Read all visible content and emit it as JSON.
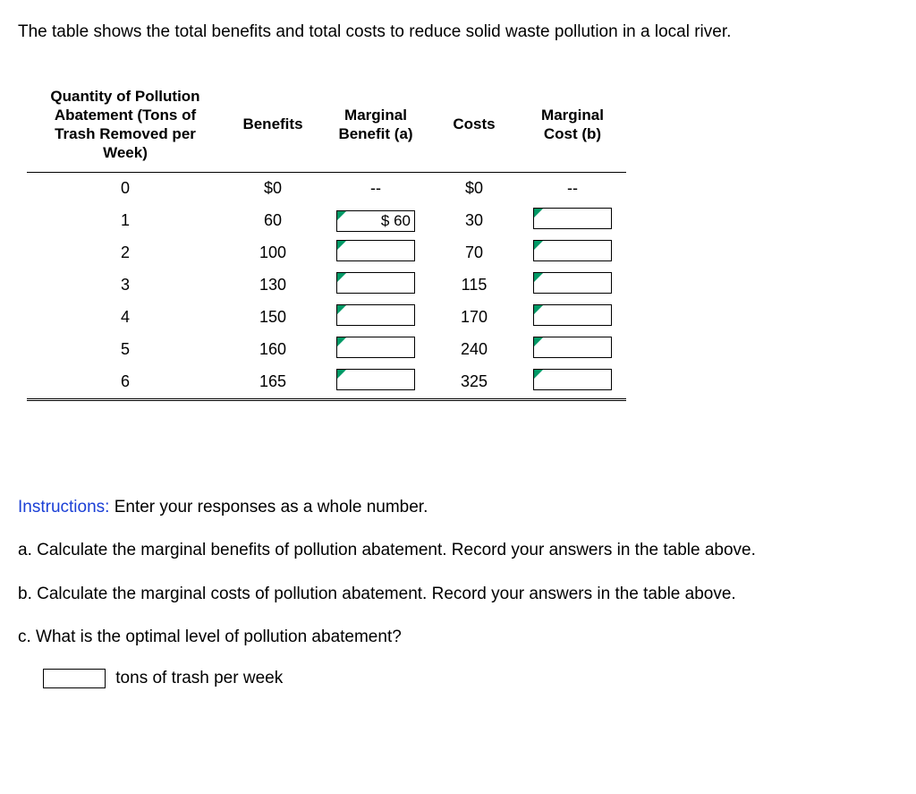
{
  "intro": "The table shows the total benefits and total costs to reduce solid waste pollution in a local river.",
  "headers": {
    "qty": "Quantity of Pollution Abatement (Tons of Trash Removed per Week)",
    "benefits": "Benefits",
    "mb": "Marginal Benefit (a)",
    "costs": "Costs",
    "mc": "Marginal Cost (b)"
  },
  "chart_data": {
    "type": "table",
    "columns": [
      "Quantity",
      "Benefits",
      "Marginal Benefit (a)",
      "Costs",
      "Marginal Cost (b)"
    ],
    "rows": [
      {
        "qty": "0",
        "benefits": "$0",
        "mb": "--",
        "costs": "$0",
        "mc": "--"
      },
      {
        "qty": "1",
        "benefits": "60",
        "mb": "$      60",
        "costs": "30",
        "mc": ""
      },
      {
        "qty": "2",
        "benefits": "100",
        "mb": "",
        "costs": "70",
        "mc": ""
      },
      {
        "qty": "3",
        "benefits": "130",
        "mb": "",
        "costs": "115",
        "mc": ""
      },
      {
        "qty": "4",
        "benefits": "150",
        "mb": "",
        "costs": "170",
        "mc": ""
      },
      {
        "qty": "5",
        "benefits": "160",
        "mb": "",
        "costs": "240",
        "mc": ""
      },
      {
        "qty": "6",
        "benefits": "165",
        "mb": "",
        "costs": "325",
        "mc": ""
      }
    ]
  },
  "instructions_label": "Instructions:",
  "instructions_text": " Enter your responses as a whole number.",
  "qa": "a. Calculate the marginal benefits of pollution abatement. Record your answers in the table above.",
  "qb": "b. Calculate the marginal costs of pollution abatement. Record your answers in the table above.",
  "qc": "c. What is the optimal level of pollution abatement?",
  "qc_unit": "tons of trash per week"
}
